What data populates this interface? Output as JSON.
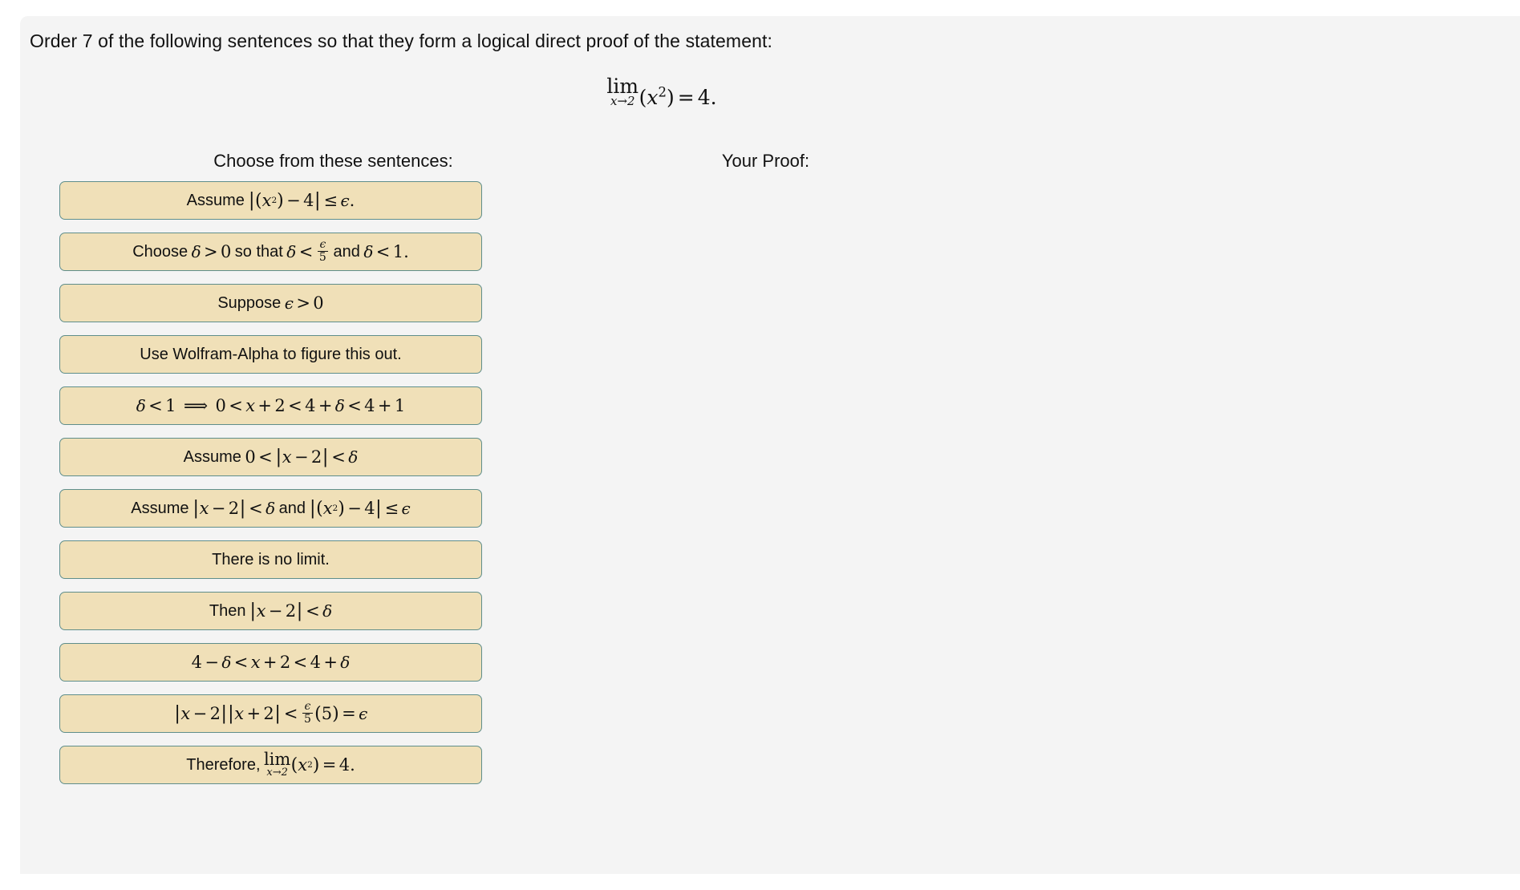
{
  "prompt": {
    "heading": "Order 7 of the following sentences so that they form a logical direct proof of the statement:"
  },
  "statement": {
    "latex": "\\lim_{x \\to 2}(x^2) = 4.",
    "plain": "lim x→2 (x^2) = 4.",
    "limit_operator": "lim",
    "limit_subscript": "x→2",
    "expression": "(x",
    "exponent": "2",
    "close_paren": ")",
    "equals": "=",
    "value": "4."
  },
  "columns": {
    "bank_heading": "Choose from these sentences:",
    "proof_heading": "Your Proof:"
  },
  "style": {
    "tile_fill": "#f0e0b8",
    "tile_border": "#5f8e8b",
    "panel_background": "#f4f4f4",
    "page_background": "#ffffff",
    "text_color": "#111111"
  },
  "sentence_bank": [
    {
      "id": 1,
      "plain": "Assume |(x^2) - 4| <= epsilon."
    },
    {
      "id": 2,
      "plain": "Choose delta > 0 so that delta < epsilon/5 and delta < 1."
    },
    {
      "id": 3,
      "plain": "Suppose epsilon > 0"
    },
    {
      "id": 4,
      "plain": "Use Wolfram-Alpha to figure this out."
    },
    {
      "id": 5,
      "plain": "delta < 1 ==> 0 < x + 2 < 4 + delta < 4 + 1"
    },
    {
      "id": 6,
      "plain": "Assume 0 < |x - 2| < delta"
    },
    {
      "id": 7,
      "plain": "Assume |x - 2| < delta and |(x^2) - 4| <= epsilon"
    },
    {
      "id": 8,
      "plain": "There is no limit."
    },
    {
      "id": 9,
      "plain": "Then |x - 2| < delta"
    },
    {
      "id": 10,
      "plain": "4 - delta < x + 2 < 4 + delta"
    },
    {
      "id": 11,
      "plain": "|x - 2||x + 2| < (epsilon/5)(5) = epsilon"
    },
    {
      "id": 12,
      "plain": "Therefore, lim x→2 (x^2) = 4."
    }
  ],
  "tokens": {
    "assume": "Assume",
    "choose": "Choose",
    "so_that": "so that",
    "and": "and",
    "suppose": "Suppose",
    "wolfram": "Use Wolfram-Alpha to figure this out.",
    "no_limit": "There is no limit.",
    "then": "Then",
    "therefore": "Therefore,",
    "epsilon": "ϵ",
    "delta": "δ",
    "x": "x",
    "lt": "<",
    "gt": ">",
    "le": "≤",
    "eq": "=",
    "plus": "+",
    "minus": "−",
    "implies": "⟹",
    "bar": "|",
    "lparen": "(",
    "rparen": ")",
    "zero": "0",
    "one": "1",
    "two": "2",
    "four": "4",
    "five": "5",
    "period": ".",
    "exp_two": "2",
    "lim": "lim",
    "x_to_2": "x→2"
  },
  "proof_column": {
    "items": []
  }
}
